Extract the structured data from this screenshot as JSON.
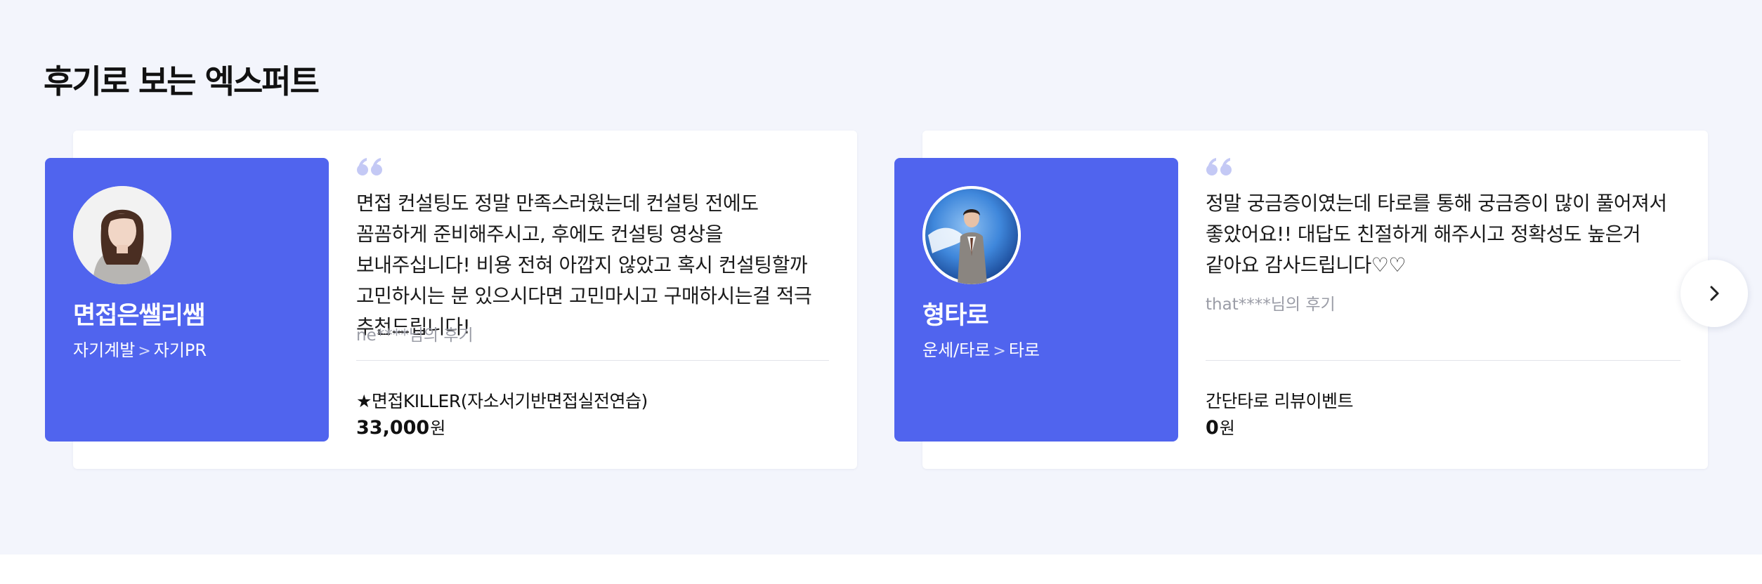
{
  "section": {
    "title": "후기로 보는 엑스퍼트"
  },
  "reviews": [
    {
      "expert_name": "면접은쌜리쌤",
      "category": "자기계발",
      "subcategory": "자기PR",
      "review_text": "면접 컨설팅도 정말 만족스러웠는데 컨설팅 전에도 꼼꼼하게 준비해주시고, 후에도 컨설팅 영상을 보내주십니다! 비용 전혀 아깝지 않았고 혹시 컨설팅할까 고민하시는 분 있으시다면 고민마시고 구매하시는걸 적극 추천드립니다!",
      "author": "ne****님의 후기",
      "product_name": "★면접KILLER(자소서기반면접실전연습)",
      "price": "33,000",
      "price_unit": "원",
      "avatar_icon": "woman-portrait-icon"
    },
    {
      "expert_name": "형타로",
      "category": "운세/타로",
      "subcategory": "타로",
      "review_text": "정말 궁금증이였는데 타로를 통해 궁금증이 많이 풀어져서 좋았어요!! 대답도 친절하게 해주시고 정확성도 높은거 같아요 감사드립니다♡♡",
      "author": "that****님의 후기",
      "product_name": "간단타로 리뷰이벤트",
      "price": "0",
      "price_unit": "원",
      "avatar_icon": "man-suit-portrait-icon"
    }
  ],
  "carousel": {
    "next_icon": "chevron-right-icon"
  },
  "colors": {
    "section_background": "#f3f5fc",
    "profile_accent": "#5064ee",
    "quote_mark": "#c4c9f5",
    "muted_text": "#9a9ca6"
  }
}
